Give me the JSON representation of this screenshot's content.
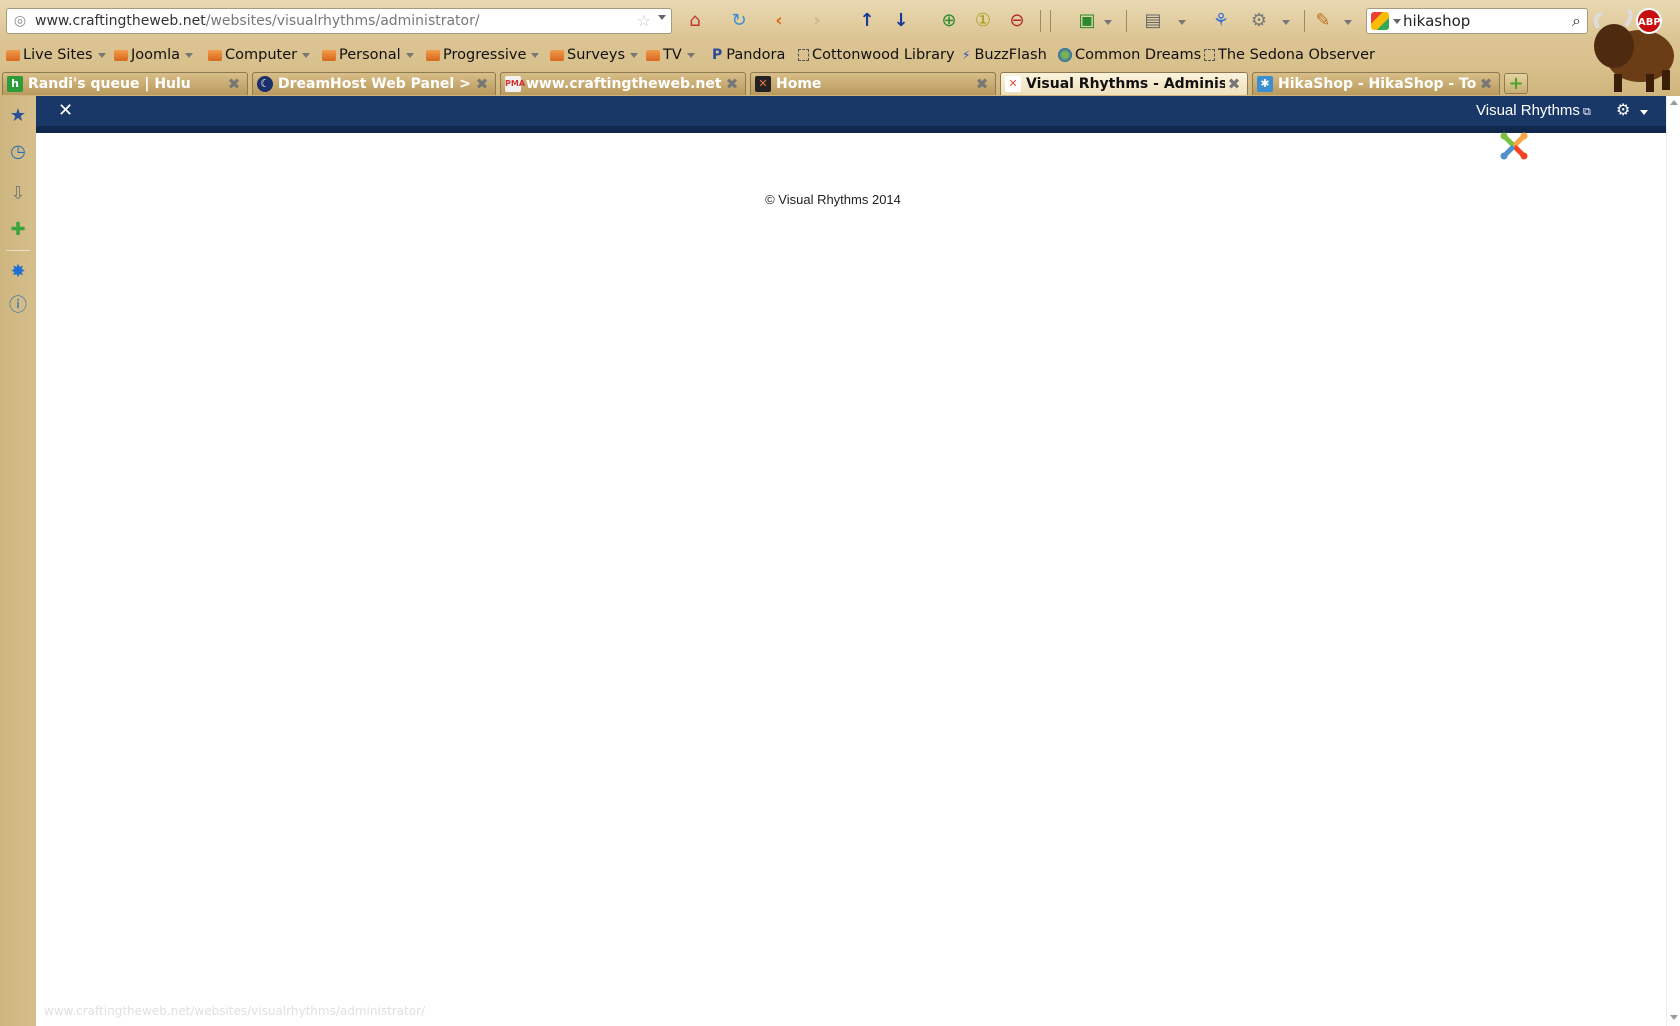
{
  "browser": {
    "url_host": "www.craftingtheweb.net",
    "url_path": "/websites/visualrhythms/administrator/",
    "search_value": "hikashop",
    "abp_label": "ABP",
    "status_url": "www.craftingtheweb.net/websites/visualrhythms/administrator/"
  },
  "bookmarks": [
    {
      "label": "Live Sites",
      "kind": "folder"
    },
    {
      "label": "Joomla",
      "kind": "folder"
    },
    {
      "label": "Computer",
      "kind": "folder"
    },
    {
      "label": "Personal",
      "kind": "folder"
    },
    {
      "label": "Progressive",
      "kind": "folder"
    },
    {
      "label": "Surveys",
      "kind": "folder"
    },
    {
      "label": "TV",
      "kind": "folder"
    },
    {
      "label": "Pandora",
      "kind": "link"
    },
    {
      "label": "Cottonwood Library",
      "kind": "link"
    },
    {
      "label": "BuzzFlash",
      "kind": "link"
    },
    {
      "label": "Common Dreams",
      "kind": "link"
    },
    {
      "label": "The Sedona Observer",
      "kind": "link"
    }
  ],
  "tabs": [
    {
      "title": "Randi's queue | Hulu",
      "active": false
    },
    {
      "title": "DreamHost Web Panel > ...",
      "active": false
    },
    {
      "title": "www.craftingtheweb.net ...",
      "active": false
    },
    {
      "title": "Home",
      "active": false
    },
    {
      "title": "Visual Rhythms - Adminis...",
      "active": true
    },
    {
      "title": "HikaShop - HikaShop - To...",
      "active": false
    }
  ],
  "admin": {
    "site_link": "Visual Rhythms",
    "footer": "© Visual Rhythms 2014"
  },
  "colors": {
    "admin_header": "#1a3867",
    "chrome": "#d8c08c"
  }
}
